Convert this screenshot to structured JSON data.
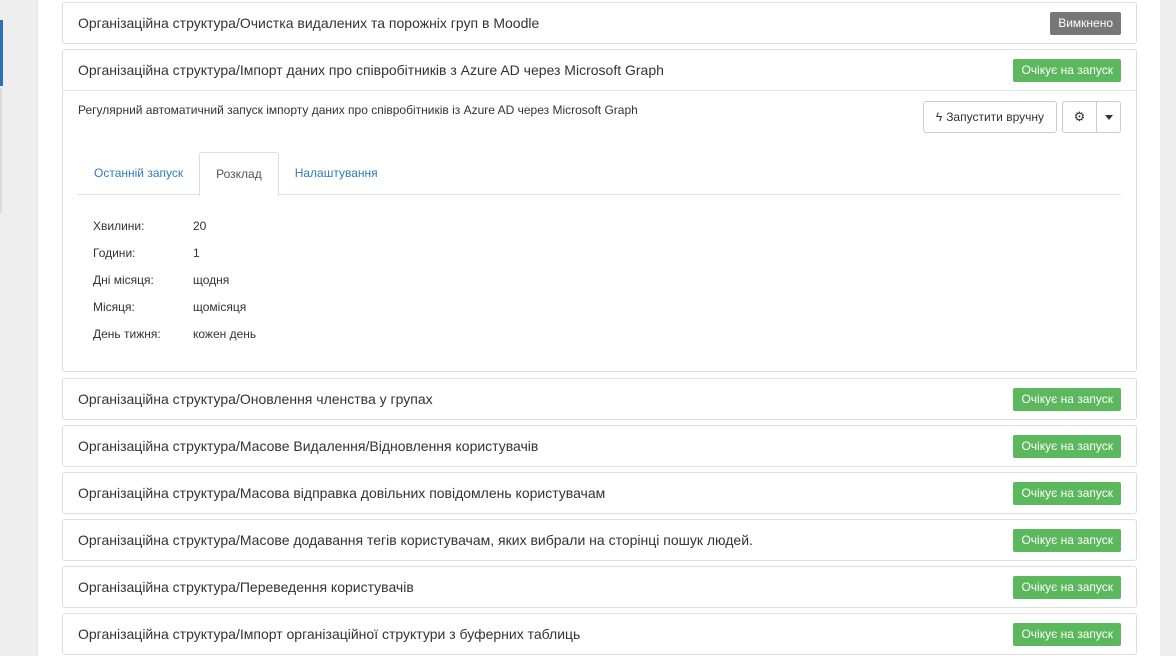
{
  "tasks": [
    {
      "title": "Організаційна структура/Очистка видалених та порожніх груп в Moodle",
      "status": "Вимкнено"
    },
    {
      "title": "Організаційна структура/Імпорт даних про співробітників з Azure AD через Microsoft Graph",
      "status": "Очікує на запуск"
    },
    {
      "title": "Організаційна структура/Оновлення членства у групах",
      "status": "Очікує на запуск"
    },
    {
      "title": "Організаційна структура/Масове Видалення/Відновлення користувачів",
      "status": "Очікує на запуск"
    },
    {
      "title": "Організаційна структура/Масова відправка довільних повідомлень користувачам",
      "status": "Очікує на запуск"
    },
    {
      "title": "Організаційна структура/Масове додавання тегів користувачам, яких вибрали на сторінці пошук людей.",
      "status": "Очікує на запуск"
    },
    {
      "title": "Організаційна структура/Переведення користувачів",
      "status": "Очікує на запуск"
    },
    {
      "title": "Організаційна структура/Імпорт організаційної структури з буферних таблиць",
      "status": "Очікує на запуск"
    }
  ],
  "expanded": {
    "description": "Регулярний автоматичний запуск імпорту даних про співробітників із Azure AD через Microsoft Graph",
    "run_button": "Запустити вручну",
    "tabs": [
      "Останній запуск",
      "Розклад",
      "Налаштування"
    ],
    "schedule": [
      {
        "label": "Хвилини:",
        "value": "20"
      },
      {
        "label": "Години:",
        "value": "1"
      },
      {
        "label": "Дні місяця:",
        "value": "щодня"
      },
      {
        "label": "Місяця:",
        "value": "щомісяця"
      },
      {
        "label": "День тижня:",
        "value": "кожен день"
      }
    ]
  },
  "colors": {
    "waiting": "#5cb85c",
    "disabled": "#777777",
    "link": "#337ab7"
  }
}
